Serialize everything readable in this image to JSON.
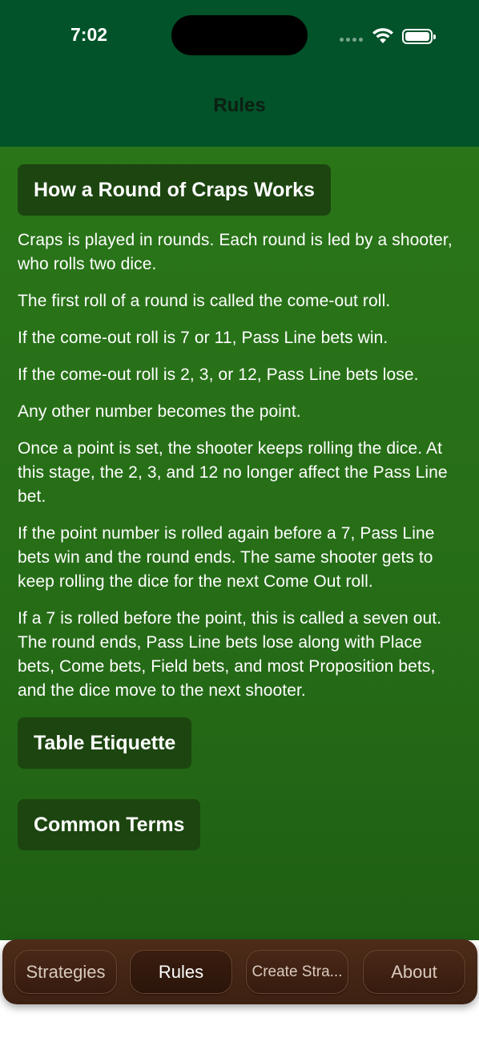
{
  "status": {
    "time": "7:02"
  },
  "nav": {
    "title": "Rules"
  },
  "sections": {
    "round": {
      "label": "How a Round of Craps Works",
      "paragraphs": [
        "Craps is played in rounds. Each round is led by a shooter, who rolls two dice.",
        "The first roll of a round is called the come-out roll.",
        "If the come-out roll is 7 or 11, Pass Line bets win.",
        "If the come-out roll is 2, 3, or 12, Pass Line bets lose.",
        "Any other number becomes the point.",
        "Once a point is set, the shooter keeps rolling the dice. At this stage, the 2, 3, and 12 no longer affect the Pass Line bet.",
        "If the point number is rolled again before a 7, Pass Line bets win and the round ends. The same shooter gets to keep rolling the dice for the next Come Out roll.",
        "If a 7 is rolled before the point, this is called a seven out. The round ends, Pass Line bets lose along with Place bets, Come bets, Field bets, and most Proposition bets, and the dice move to the next shooter."
      ]
    },
    "etiquette": {
      "label": "Table Etiquette"
    },
    "terms": {
      "label": "Common Terms"
    }
  },
  "tabs": [
    {
      "label": "Strategies"
    },
    {
      "label": "Rules"
    },
    {
      "label": "Create Stra..."
    },
    {
      "label": "About"
    }
  ],
  "colors": {
    "header": "#02532a",
    "content": "#2a7518",
    "section_button": "#1c4510",
    "tabbar": "#4d2c19"
  }
}
